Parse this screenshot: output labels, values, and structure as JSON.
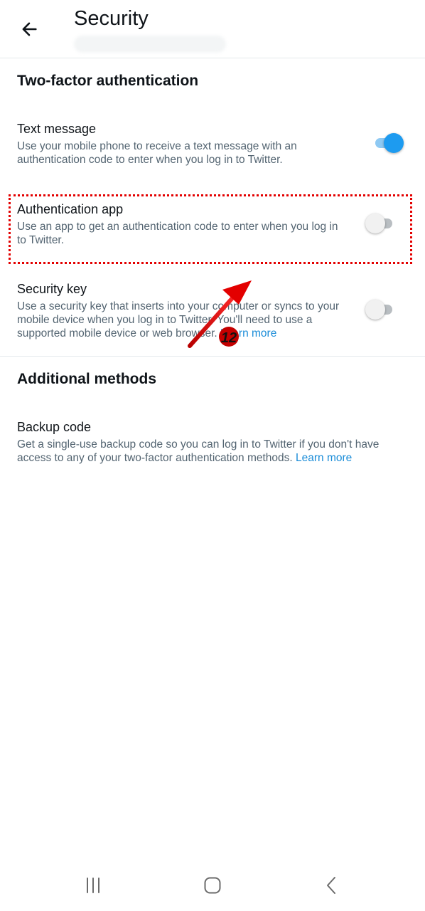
{
  "header": {
    "title": "Security"
  },
  "two_factor": {
    "section_title": "Two-factor authentication",
    "items": [
      {
        "label": "Text message",
        "description": "Use your mobile phone to receive a text message with an authentication code to enter when you log in to Twitter.",
        "toggle_state": "on"
      },
      {
        "label": "Authentication app",
        "description": "Use an app to get an authentication code to enter when you log in to Twitter.",
        "toggle_state": "off"
      },
      {
        "label": "Security key",
        "description": "Use a security key that inserts into your computer or syncs to your mobile device when you log in to Twitter. You'll need to use a supported mobile device or web browser.",
        "link": "Learn more",
        "toggle_state": "off"
      }
    ]
  },
  "additional": {
    "section_title": "Additional methods",
    "items": [
      {
        "label": "Backup code",
        "description": "Get a single-use backup code so you can log in to Twitter if you don't have access to any of your two-factor authentication methods.",
        "link": "Learn more"
      }
    ]
  },
  "annotation": {
    "step_number": "12",
    "color": "#e30000"
  },
  "colors": {
    "accent": "#1d9bf0",
    "text_secondary": "#536471",
    "link": "#1a8cd8"
  },
  "nav": {
    "icons": [
      "recent-apps-icon",
      "home-icon",
      "back-icon"
    ]
  }
}
